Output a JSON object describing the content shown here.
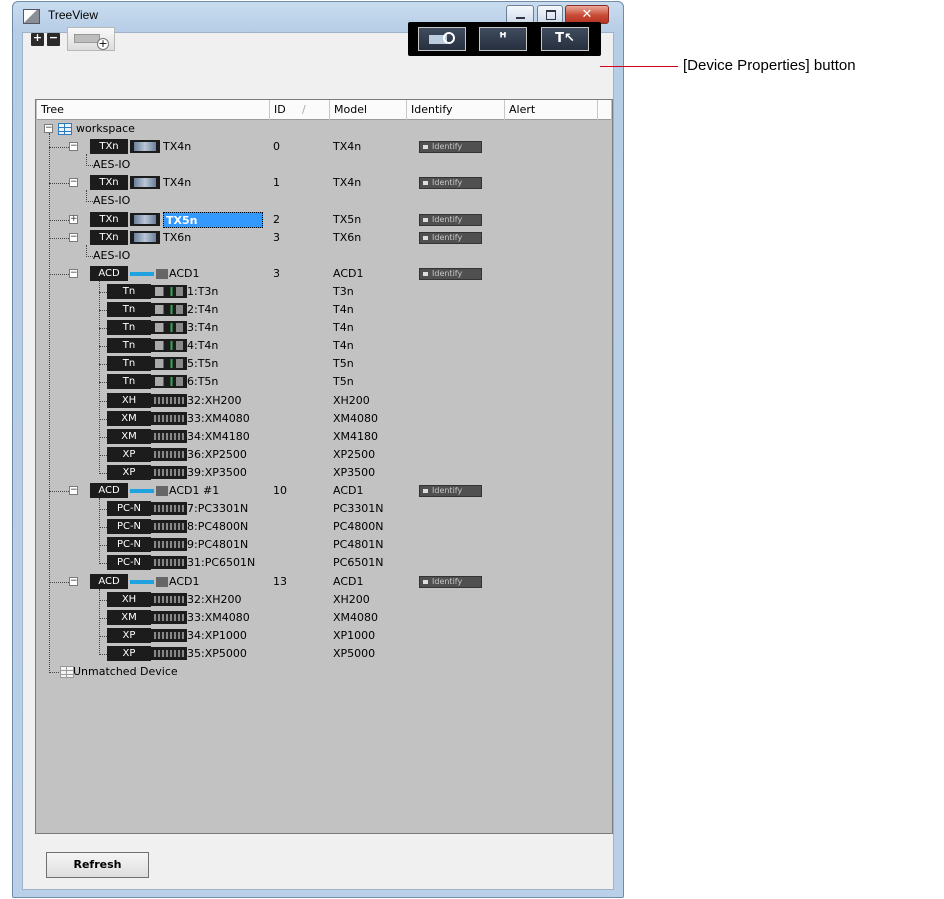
{
  "window": {
    "title": "TreeView",
    "close_glyph": "✕"
  },
  "toolbar": {
    "expand_all_glyph": "+",
    "collapse_all_glyph": "−",
    "add_device_glyph": "+",
    "meter_glyph": "ꟸ",
    "device_properties_glyph": "T↖"
  },
  "columns": {
    "tree": "Tree",
    "id": "ID",
    "sort_indicator": "/",
    "model": "Model",
    "identify": "Identify",
    "alert": "Alert"
  },
  "identify_label": "Identify",
  "tree": [
    {
      "kind": "workspace",
      "label": "workspace"
    },
    {
      "kind": "device",
      "tag": "TXn",
      "img": "tx",
      "label": "TX4n",
      "id": "0",
      "model": "TX4n",
      "identify": true,
      "expander": "-"
    },
    {
      "kind": "sub",
      "label": "AES-IO"
    },
    {
      "kind": "device",
      "tag": "TXn",
      "img": "tx",
      "label": "TX4n",
      "id": "1",
      "model": "TX4n",
      "identify": true,
      "expander": "-"
    },
    {
      "kind": "sub",
      "label": "AES-IO"
    },
    {
      "kind": "device",
      "tag": "TXn",
      "img": "tx",
      "label": "TX5n",
      "id": "2",
      "model": "TX5n",
      "identify": true,
      "expander": "+",
      "selected": true
    },
    {
      "kind": "device",
      "tag": "TXn",
      "img": "tx",
      "label": "TX6n",
      "id": "3",
      "model": "TX6n",
      "identify": true,
      "expander": "-"
    },
    {
      "kind": "sub",
      "label": "AES-IO"
    },
    {
      "kind": "device",
      "tag": "ACD",
      "img": "acd",
      "label": "ACD1",
      "id": "3",
      "model": "ACD1",
      "identify": true,
      "expander": "-"
    },
    {
      "kind": "amp",
      "tag": "Tn",
      "img": "t",
      "label": "1:T3n",
      "model": "T3n"
    },
    {
      "kind": "amp",
      "tag": "Tn",
      "img": "t",
      "label": "2:T4n",
      "model": "T4n"
    },
    {
      "kind": "amp",
      "tag": "Tn",
      "img": "t",
      "label": "3:T4n",
      "model": "T4n"
    },
    {
      "kind": "amp",
      "tag": "Tn",
      "img": "t",
      "label": "4:T4n",
      "model": "T4n"
    },
    {
      "kind": "amp",
      "tag": "Tn",
      "img": "t",
      "label": "5:T5n",
      "model": "T5n"
    },
    {
      "kind": "amp",
      "tag": "Tn",
      "img": "t",
      "label": "6:T5n",
      "model": "T5n"
    },
    {
      "kind": "amp",
      "tag": "XH",
      "img": "amp",
      "label": "32:XH200",
      "model": "XH200"
    },
    {
      "kind": "amp",
      "tag": "XM",
      "img": "amp",
      "label": "33:XM4080",
      "model": "XM4080"
    },
    {
      "kind": "amp",
      "tag": "XM",
      "img": "amp",
      "label": "34:XM4180",
      "model": "XM4180"
    },
    {
      "kind": "amp",
      "tag": "XP",
      "img": "amp",
      "label": "36:XP2500",
      "model": "XP2500"
    },
    {
      "kind": "amp",
      "tag": "XP",
      "img": "amp",
      "label": "39:XP3500",
      "model": "XP3500",
      "last": true
    },
    {
      "kind": "device",
      "tag": "ACD",
      "img": "acd",
      "label": "ACD1 #1",
      "id": "10",
      "model": "ACD1",
      "identify": true,
      "expander": "-"
    },
    {
      "kind": "amp",
      "tag": "PC-N",
      "img": "amp",
      "label": "7:PC3301N",
      "model": "PC3301N"
    },
    {
      "kind": "amp",
      "tag": "PC-N",
      "img": "amp",
      "label": "8:PC4800N",
      "model": "PC4800N"
    },
    {
      "kind": "amp",
      "tag": "PC-N",
      "img": "amp",
      "label": "9:PC4801N",
      "model": "PC4801N"
    },
    {
      "kind": "amp",
      "tag": "PC-N",
      "img": "amp",
      "label": "31:PC6501N",
      "model": "PC6501N",
      "last": true
    },
    {
      "kind": "device",
      "tag": "ACD",
      "img": "acd",
      "label": "ACD1",
      "id": "13",
      "model": "ACD1",
      "identify": true,
      "expander": "-"
    },
    {
      "kind": "amp",
      "tag": "XH",
      "img": "amp",
      "label": "32:XH200",
      "model": "XH200"
    },
    {
      "kind": "amp",
      "tag": "XM",
      "img": "amp",
      "label": "33:XM4080",
      "model": "XM4080"
    },
    {
      "kind": "amp",
      "tag": "XP",
      "img": "amp",
      "label": "34:XP1000",
      "model": "XP1000"
    },
    {
      "kind": "amp",
      "tag": "XP",
      "img": "amp",
      "label": "35:XP5000",
      "model": "XP5000",
      "last": true
    },
    {
      "kind": "unmatched",
      "label": "Unmatched Device"
    }
  ],
  "buttons": {
    "refresh": "Refresh"
  },
  "callout": {
    "text": "[Device Properties] button",
    "color": "#d0021b"
  },
  "colors": {
    "selection": "#3399ff",
    "tree_background": "#c2c2c2"
  }
}
